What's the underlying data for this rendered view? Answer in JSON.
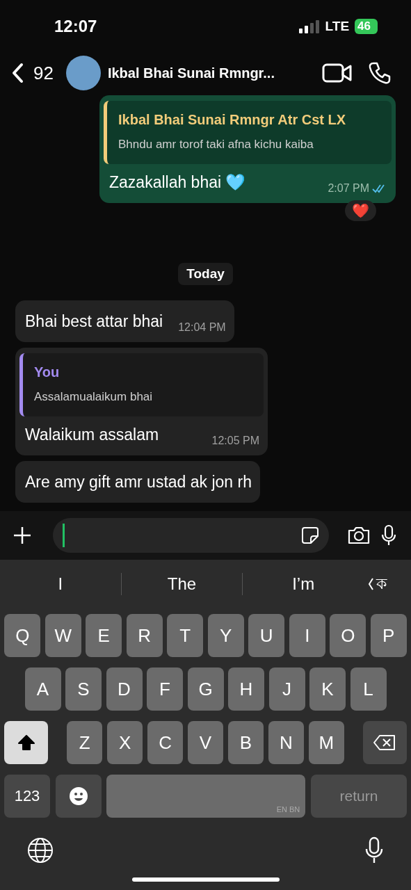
{
  "status_bar": {
    "time": "12:07",
    "network": "LTE",
    "battery": "46"
  },
  "header": {
    "unread_count": "92",
    "title": "Ikbal Bhai Sunai Rmngr..."
  },
  "messages": [
    {
      "kind": "sent",
      "quote": {
        "author": "Ikbal Bhai Sunai Rmngr Atr Cst LX",
        "text": "Bhndu amr torof taki afna kichu kaiba"
      },
      "text": "Zazakallah bhai 🩵",
      "time": "2:07 PM",
      "read": true,
      "reaction": "❤️"
    },
    {
      "kind": "date",
      "text": "Today"
    },
    {
      "kind": "received",
      "text": "Bhai best attar bhai",
      "time": "12:04 PM"
    },
    {
      "kind": "received",
      "quote": {
        "author": "You",
        "text": "Assalamualaikum bhai"
      },
      "text": "Walaikum assalam",
      "time": "12:05 PM"
    },
    {
      "kind": "received",
      "text": "Are amy gift amr ustad ak jon rh"
    }
  ],
  "suggestions": [
    "I",
    "The",
    "I’m",
    "ক"
  ],
  "keyboard": {
    "rows": [
      {
        "keys": [
          {
            "kind": "letter",
            "label": "Q"
          },
          {
            "kind": "letter",
            "label": "W"
          },
          {
            "kind": "letter",
            "label": "E"
          },
          {
            "kind": "letter",
            "label": "R"
          },
          {
            "kind": "letter",
            "label": "T"
          },
          {
            "kind": "letter",
            "label": "Y"
          },
          {
            "kind": "letter",
            "label": "U"
          },
          {
            "kind": "letter",
            "label": "I"
          },
          {
            "kind": "letter",
            "label": "O"
          },
          {
            "kind": "letter",
            "label": "P"
          }
        ]
      },
      {
        "keys": [
          {
            "kind": "letter",
            "label": "A"
          },
          {
            "kind": "letter",
            "label": "S"
          },
          {
            "kind": "letter",
            "label": "D"
          },
          {
            "kind": "letter",
            "label": "F"
          },
          {
            "kind": "letter",
            "label": "G"
          },
          {
            "kind": "letter",
            "label": "H"
          },
          {
            "kind": "letter",
            "label": "J"
          },
          {
            "kind": "letter",
            "label": "K"
          },
          {
            "kind": "letter",
            "label": "L"
          }
        ]
      },
      {
        "keys": [
          {
            "kind": "shift",
            "on": true
          },
          {
            "kind": "letter",
            "label": "Z"
          },
          {
            "kind": "letter",
            "label": "X"
          },
          {
            "kind": "letter",
            "label": "C"
          },
          {
            "kind": "letter",
            "label": "V"
          },
          {
            "kind": "letter",
            "label": "B"
          },
          {
            "kind": "letter",
            "label": "N"
          },
          {
            "kind": "letter",
            "label": "M"
          },
          {
            "kind": "delete"
          }
        ]
      },
      {
        "keys": [
          {
            "kind": "numbers",
            "label": "123"
          },
          {
            "kind": "emoji"
          },
          {
            "kind": "space",
            "label": "EN BN"
          },
          {
            "kind": "return",
            "label": "return",
            "disabled": true
          }
        ]
      }
    ]
  }
}
